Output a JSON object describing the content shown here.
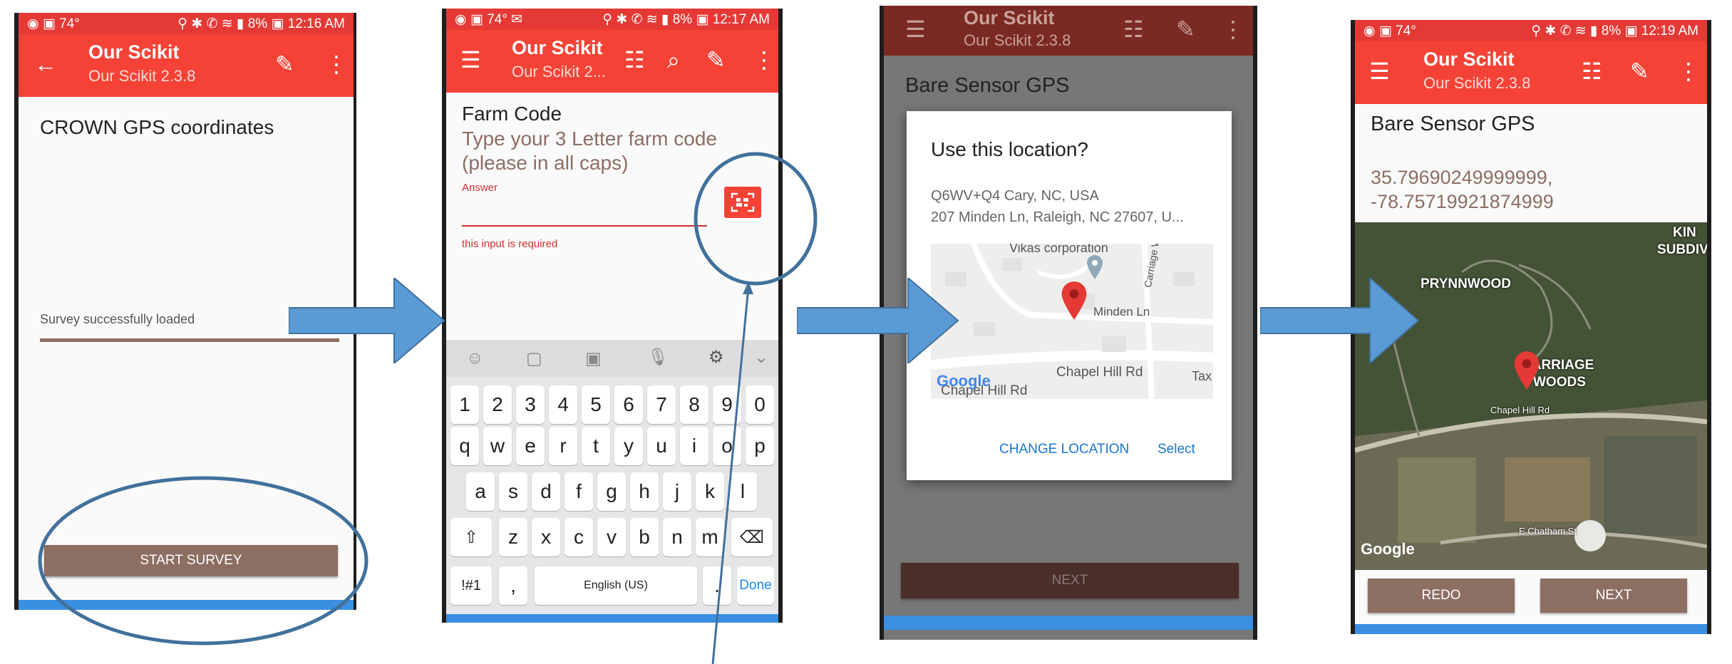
{
  "status_bar": {
    "temp": "74°",
    "battery": "8%",
    "times": [
      "12:16 AM",
      "12:17 AM",
      "12:19 AM"
    ]
  },
  "app": {
    "title": "Our Scikit",
    "subtitle": "Our Scikit 2.3.8",
    "subtitle_truncated": "Our Scikit 2..."
  },
  "screen1": {
    "question": "CROWN GPS coordinates",
    "status": "Survey successfully loaded",
    "button": "START SURVEY"
  },
  "screen2": {
    "label": "Farm Code",
    "hint": "Type your 3 Letter farm code (please in all caps)",
    "answer_label": "Answer",
    "error": "this input is required",
    "keyboard": {
      "numbers": [
        "1",
        "2",
        "3",
        "4",
        "5",
        "6",
        "7",
        "8",
        "9",
        "0"
      ],
      "row1": [
        "q",
        "w",
        "e",
        "r",
        "t",
        "y",
        "u",
        "i",
        "o",
        "p"
      ],
      "row2": [
        "a",
        "s",
        "d",
        "f",
        "g",
        "h",
        "j",
        "k",
        "l"
      ],
      "row3": [
        "z",
        "x",
        "c",
        "v",
        "b",
        "n",
        "m"
      ],
      "sym": "!#1",
      "comma": ",",
      "space": "English (US)",
      "period": ".",
      "done": "Done"
    }
  },
  "screen3": {
    "question": "Bare Sensor GPS",
    "dialog_title": "Use this location?",
    "addr1": "Q6WV+Q4 Cary, NC, USA",
    "addr2": "207 Minden Ln, Raleigh, NC 27607, U...",
    "map_labels": [
      "Vikas corporation",
      "Minden Ln",
      "Carriage Woods Cir",
      "Chapel Hill Rd",
      "Chapel Hill Rd",
      "Tax"
    ],
    "google": "Google",
    "change_location": "CHANGE LOCATION",
    "select": "Select",
    "next": "NEXT"
  },
  "screen4": {
    "question": "Bare Sensor GPS",
    "lat": "35.79690249999999,",
    "lng": "-78.75719921874999",
    "map_labels": [
      "PRYNNWOOD",
      "CARRIAGE",
      "WOODS",
      "KIN",
      "SUBDIV",
      "Chapel Hill Rd",
      "E Chatham St"
    ],
    "google": "Google",
    "redo": "REDO",
    "next": "NEXT"
  },
  "colors": {
    "status_bar": "#e53935",
    "app_bar": "#f44336",
    "button": "#8d6e63",
    "arrow": "#5b9bd5",
    "annotation": "#41719c",
    "link": "#1976d2"
  }
}
